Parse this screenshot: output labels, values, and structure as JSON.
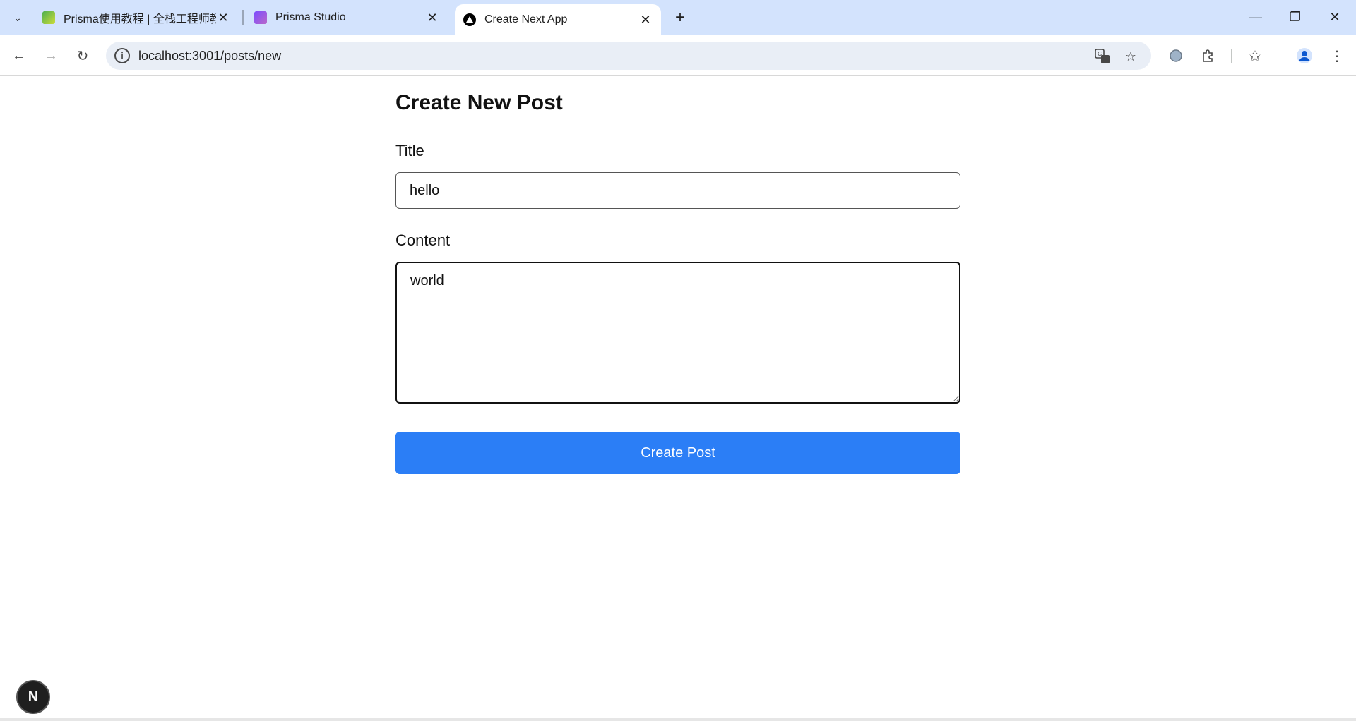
{
  "browser": {
    "tabs": [
      {
        "title": "Prisma使用教程 | 全栈工程师教",
        "favicon": "prisma-docs-favicon",
        "favicon_color": "#4caf50",
        "active": false
      },
      {
        "title": "Prisma Studio",
        "favicon": "prisma-studio-favicon",
        "favicon_color": "#9c4dcc",
        "active": false
      },
      {
        "title": "Create Next App",
        "favicon": "nextjs-favicon",
        "favicon_color": "#000000",
        "active": true
      }
    ],
    "new_tab_label": "+",
    "url": "localhost:3001/posts/new"
  },
  "page": {
    "heading": "Create New Post",
    "title_label": "Title",
    "title_value": "hello",
    "content_label": "Content",
    "content_value": "world",
    "submit_label": "Create Post",
    "next_badge": "N"
  },
  "colors": {
    "accent": "#2b7ef6",
    "tabstrip": "#d3e3fd",
    "omnibox": "#e9eef6"
  }
}
